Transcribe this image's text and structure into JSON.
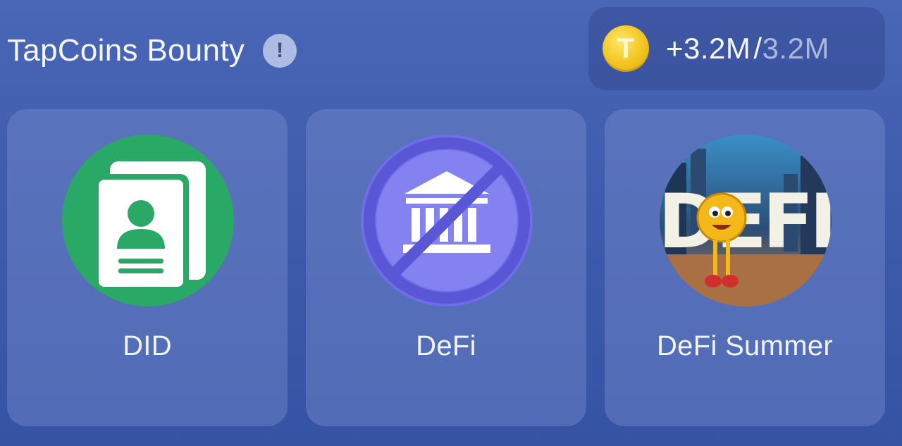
{
  "header": {
    "title": "TapCoins Bounty",
    "info_symbol": "!",
    "balance": {
      "coin_symbol": "T",
      "earned": "+3.2M",
      "separator": "/",
      "total": "3.2M"
    }
  },
  "cards": [
    {
      "label": "DID",
      "icon": "id-card-icon",
      "icon_bg": "#2aa866"
    },
    {
      "label": "DeFi",
      "icon": "no-bank-icon",
      "icon_bg": "#7a78ee"
    },
    {
      "label": "DeFi Summer",
      "icon": "defi-summer-artwork",
      "artwork_text": "DEFI"
    }
  ],
  "colors": {
    "background": "#3f5bab",
    "coin": "#f2c51f",
    "total_muted": "#aab8de"
  }
}
